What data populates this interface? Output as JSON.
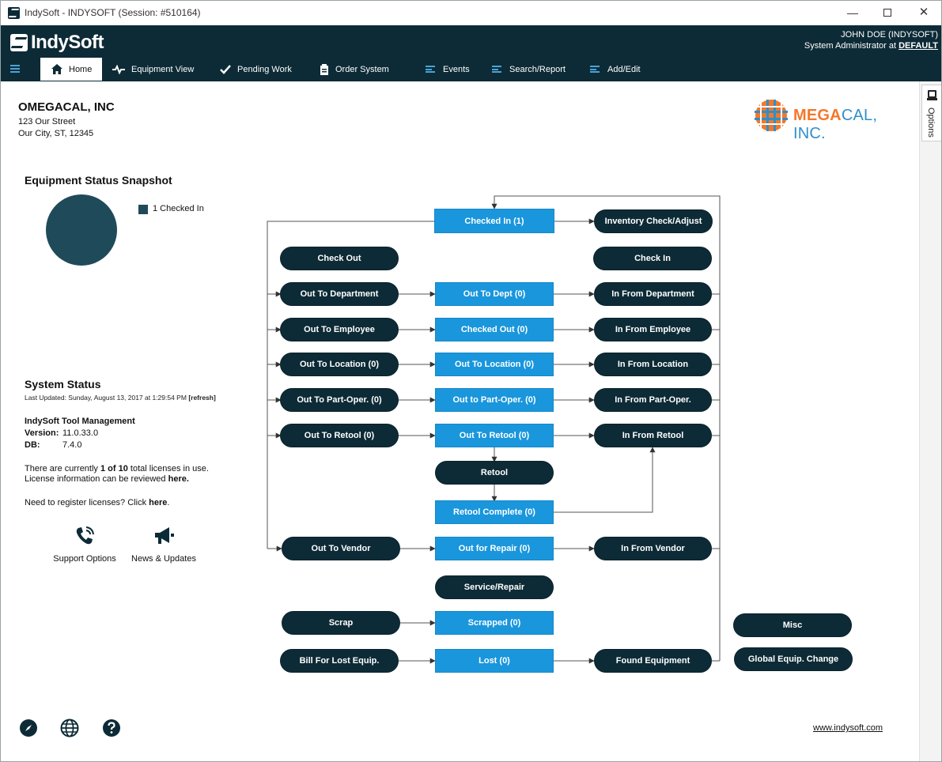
{
  "window": {
    "title": "IndySoft - INDYSOFT (Session: #510164)",
    "minimize_glyph": "—",
    "close_glyph": "✕"
  },
  "header": {
    "logo_text": "IndySoft",
    "user_name": "JOHN DOE (INDYSOFT)",
    "user_role_prefix": "System Administrator at ",
    "user_role_location": "DEFAULT"
  },
  "nav": {
    "tabs": [
      {
        "label": "Home",
        "icon": "home-icon"
      },
      {
        "label": "Equipment View",
        "icon": "pulse-icon"
      },
      {
        "label": "Pending Work",
        "icon": "check-icon"
      },
      {
        "label": "Order System",
        "icon": "clipboard-icon"
      },
      {
        "label": "Events",
        "icon": "list-icon"
      },
      {
        "label": "Search/Report",
        "icon": "list-icon"
      },
      {
        "label": "Add/Edit",
        "icon": "list-icon"
      }
    ]
  },
  "options": {
    "label": "Options"
  },
  "company": {
    "name": "OMEGACAL, INC",
    "address_line1": "123 Our Street",
    "address_line2": "Our City, ST, 12345",
    "logo_accent": "MEGA",
    "logo_rest": "CAL, INC."
  },
  "snapshot": {
    "title": "Equipment Status Snapshot",
    "legend": "1 Checked In",
    "color": "#1f4a5a"
  },
  "system_status": {
    "title": "System Status",
    "last_updated": "Last Updated: Sunday, August 13, 2017 at 1:29:54 PM",
    "refresh": "[refresh]",
    "product": "IndySoft Tool Management",
    "version_label": "Version:",
    "version_value": "11.0.33.0",
    "db_label": "DB:",
    "db_value": "7.4.0",
    "licenses_pre": "There are currently ",
    "licenses_bold": "1 of 10",
    "licenses_post": " total licenses in use.",
    "license_info_pre": "License information can be reviewed ",
    "license_info_link": "here.",
    "register_pre": "Need to register licenses? Click ",
    "register_link": "here",
    "register_post": "."
  },
  "support": {
    "support_label": "Support Options",
    "news_label": "News & Updates"
  },
  "footer": {
    "website": "www.indysoft.com"
  },
  "flow": {
    "checked_in": "Checked In (1)",
    "inventory_check": "Inventory Check/Adjust",
    "check_out": "Check Out",
    "check_in": "Check In",
    "out_to_department": "Out To Department",
    "out_to_dept": "Out To Dept (0)",
    "in_from_department": "In From Department",
    "out_to_employee": "Out To Employee",
    "checked_out": "Checked Out (0)",
    "in_from_employee": "In From Employee",
    "out_to_location_action": "Out To Location (0)",
    "out_to_location_status": "Out To Location (0)",
    "in_from_location": "In From Location",
    "out_to_part_oper_action": "Out To Part-Oper. (0)",
    "out_to_part_oper_status": "Out to Part-Oper. (0)",
    "in_from_part_oper": "In From Part-Oper.",
    "out_to_retool_action": "Out To Retool (0)",
    "out_to_retool_status": "Out To Retool (0)",
    "in_from_retool": "In From Retool",
    "retool": "Retool",
    "retool_complete": "Retool Complete (0)",
    "out_to_vendor": "Out To Vendor",
    "out_for_repair": "Out for Repair (0)",
    "in_from_vendor": "In From Vendor",
    "service_repair": "Service/Repair",
    "scrap": "Scrap",
    "scrapped": "Scrapped (0)",
    "misc": "Misc",
    "bill_for_lost": "Bill For Lost Equip.",
    "lost": "Lost (0)",
    "found_equipment": "Found Equipment",
    "global_change": "Global Equip. Change"
  }
}
